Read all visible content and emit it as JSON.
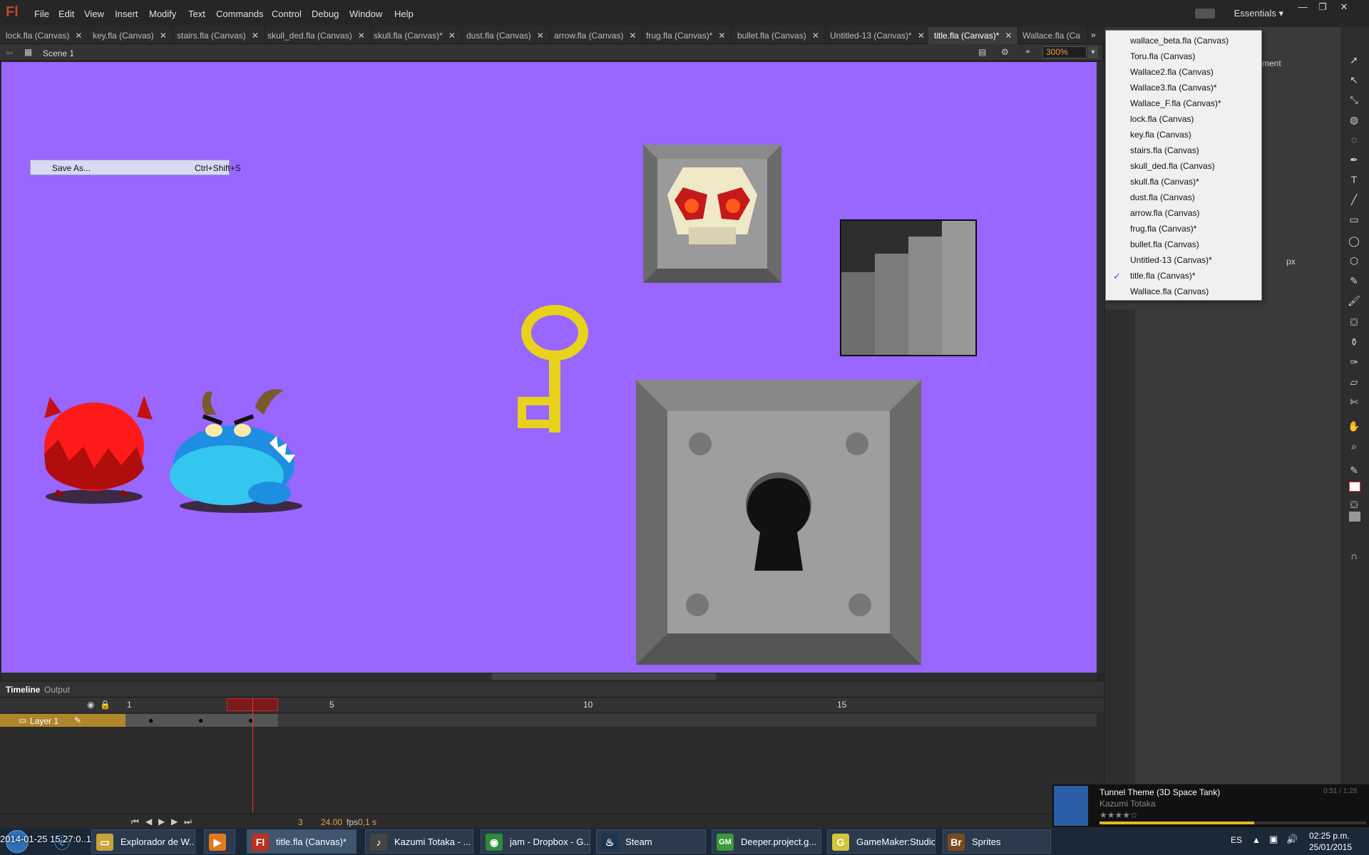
{
  "app": {
    "logo": "Fl",
    "workspace": "Essentials"
  },
  "menu": [
    "File",
    "Edit",
    "View",
    "Insert",
    "Modify",
    "Text",
    "Commands",
    "Control",
    "Debug",
    "Window",
    "Help"
  ],
  "tabs": [
    {
      "label": "lock.fla (Canvas)",
      "active": false
    },
    {
      "label": "key.fla (Canvas)",
      "active": false
    },
    {
      "label": "stairs.fla (Canvas)",
      "active": false
    },
    {
      "label": "skull_ded.fla (Canvas)",
      "active": false
    },
    {
      "label": "skull.fla (Canvas)*",
      "active": false
    },
    {
      "label": "dust.fla (Canvas)",
      "active": false
    },
    {
      "label": "arrow.fla (Canvas)",
      "active": false
    },
    {
      "label": "frug.fla (Canvas)*",
      "active": false
    },
    {
      "label": "bullet.fla (Canvas)",
      "active": false
    },
    {
      "label": "Untitled-13 (Canvas)*",
      "active": false
    },
    {
      "label": "title.fla (Canvas)*",
      "active": true
    },
    {
      "label": "Wallace.fla (Ca",
      "active": false
    }
  ],
  "tab_close": "✕",
  "scene": {
    "label": "Scene 1",
    "zoom": "300%"
  },
  "context_menu": {
    "label": "Save As...",
    "shortcut": "Ctrl+Shift+S"
  },
  "dropdown": [
    "wallace_beta.fla (Canvas)",
    "Toru.fla (Canvas)",
    "Wallace2.fla (Canvas)",
    "Wallace3.fla (Canvas)*",
    "Wallace_F.fla (Canvas)*",
    "lock.fla (Canvas)",
    "key.fla (Canvas)",
    "stairs.fla (Canvas)",
    "skull_ded.fla (Canvas)",
    "skull.fla (Canvas)*",
    "dust.fla (Canvas)",
    "arrow.fla (Canvas)",
    "frug.fla (Canvas)*",
    "bullet.fla (Canvas)",
    "Untitled-13 (Canvas)*",
    "title.fla (Canvas)*",
    "Wallace.fla (Canvas)"
  ],
  "dropdown_checked": "title.fla (Canvas)*",
  "panel_texts": {
    "element": "ment",
    "unit": "px"
  },
  "timeline": {
    "tabs": [
      "Timeline",
      "Output"
    ],
    "layer": "Layer 1",
    "frame_numbers": [
      "1",
      "5",
      "10",
      "15"
    ],
    "current_frame": "3",
    "fps": "24.00",
    "fps_unit": "fps",
    "time": "0,1 s"
  },
  "media": {
    "title": "Tunnel Theme (3D Space Tank)",
    "artist": "Kazumi Totaka",
    "time": "0:51 / 1:28",
    "rating_stars": 4,
    "progress": 0.58
  },
  "taskbar": {
    "tasks": [
      {
        "label": "Explorador de W...",
        "active": false,
        "icon": "folder-icon",
        "color": "#c9a23a",
        "glyph": "▭"
      },
      {
        "label": "",
        "active": false,
        "icon": "media-player-icon",
        "color": "#e07a1f",
        "glyph": "▶"
      },
      {
        "label": "title.fla (Canvas)*",
        "active": true,
        "icon": "flash-icon",
        "color": "#b8321f",
        "glyph": "Fl"
      },
      {
        "label": "Kazumi Totaka - ...",
        "active": false,
        "icon": "music-player-icon",
        "color": "#444",
        "glyph": "♪"
      },
      {
        "label": "jam - Dropbox - G...",
        "active": false,
        "icon": "chrome-icon",
        "color": "#2e8b3c",
        "glyph": "◉"
      },
      {
        "label": "Steam",
        "active": false,
        "icon": "steam-icon",
        "color": "#1c3550",
        "glyph": "♨"
      },
      {
        "label": "Deeper.project.g...",
        "active": false,
        "icon": "gamemaker-project-icon",
        "color": "#3a9a3a",
        "glyph": "GM"
      },
      {
        "label": "GameMaker:Studio",
        "active": false,
        "icon": "gamemaker-icon",
        "color": "#d1c53a",
        "glyph": "G"
      },
      {
        "label": "Sprites",
        "active": false,
        "icon": "bridge-icon",
        "color": "#7a4a1c",
        "glyph": "Br"
      }
    ],
    "language": "ES",
    "clock_time": "02:25 p.m.",
    "clock_date": "25/01/2015",
    "overlay_text": "2014-01-25 15:27:0..15"
  }
}
